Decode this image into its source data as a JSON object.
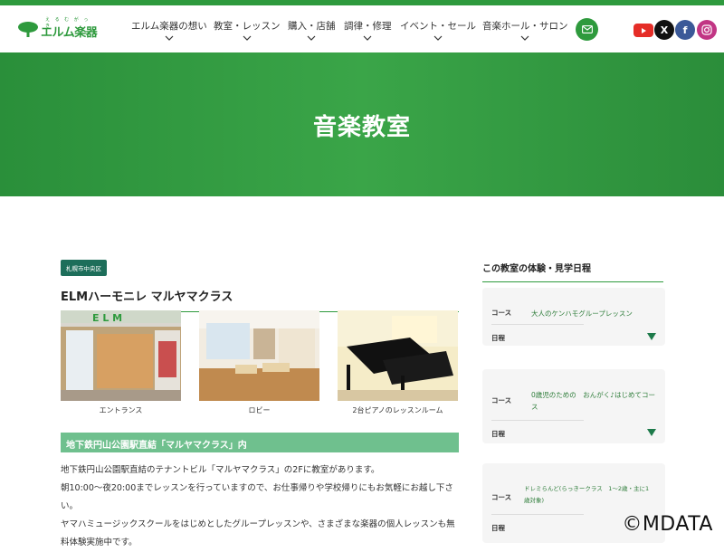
{
  "brand": {
    "name": "エルム楽器",
    "furigana": "え る む が っ き",
    "color": "#2e9a3d"
  },
  "nav": {
    "items": [
      {
        "label": "エルム楽器の想い",
        "icon": "chevron-down-icon"
      },
      {
        "label": "教室・レッスン",
        "icon": "chevron-down-icon"
      },
      {
        "label": "購入・店舗",
        "icon": "chevron-down-icon"
      },
      {
        "label": "調律・修理",
        "icon": "chevron-down-icon"
      },
      {
        "label": "イベント・セール",
        "icon": "chevron-down-icon"
      },
      {
        "label": "音楽ホール・サロン",
        "icon": "chevron-down-icon"
      }
    ],
    "mail_icon": "mail-icon",
    "social": [
      {
        "name": "youtube-icon",
        "color": "#e52d27"
      },
      {
        "name": "x-icon",
        "color": "#111111",
        "glyph": "X"
      },
      {
        "name": "facebook-icon",
        "color": "#3b5998",
        "glyph": "f"
      },
      {
        "name": "instagram-icon",
        "color": "#c13584"
      }
    ]
  },
  "hero": {
    "title": "音楽教室"
  },
  "main": {
    "area_badge": "札幌市中央区",
    "class_title": "ELMハーモニレ マルヤマクラス",
    "photos": [
      {
        "caption": "エントランス"
      },
      {
        "caption": "ロビー"
      },
      {
        "caption": "2台ピアノのレッスンルーム"
      }
    ],
    "headline": "地下鉄円山公園駅直結「マルヤマクラス」内",
    "paragraphs": [
      "地下鉄円山公園駅直結のテナントビル「マルヤマクラス」の2Fに教室があります。",
      "朝10:00〜夜20:00までレッスンを行っていますので、お仕事帰りや学校帰りにもお気軽にお越し下さい。",
      "ヤマハミュージックスクールをはじめとしたグループレッスンや、さまざまな楽器の個人レッスンも無料体験実施中です。"
    ]
  },
  "sidebar": {
    "title": "この教室の体験・見学日程",
    "course_label": "コース",
    "date_label": "日程",
    "cards": [
      {
        "course": "大人のケンハモグループレッスン"
      },
      {
        "course": "0歳児のための　おんがく♪はじめてコース"
      },
      {
        "course": "ドレミらんど(らっきークラス　1〜2歳・主に1歳対象)"
      }
    ]
  },
  "watermark": "©MDATA"
}
